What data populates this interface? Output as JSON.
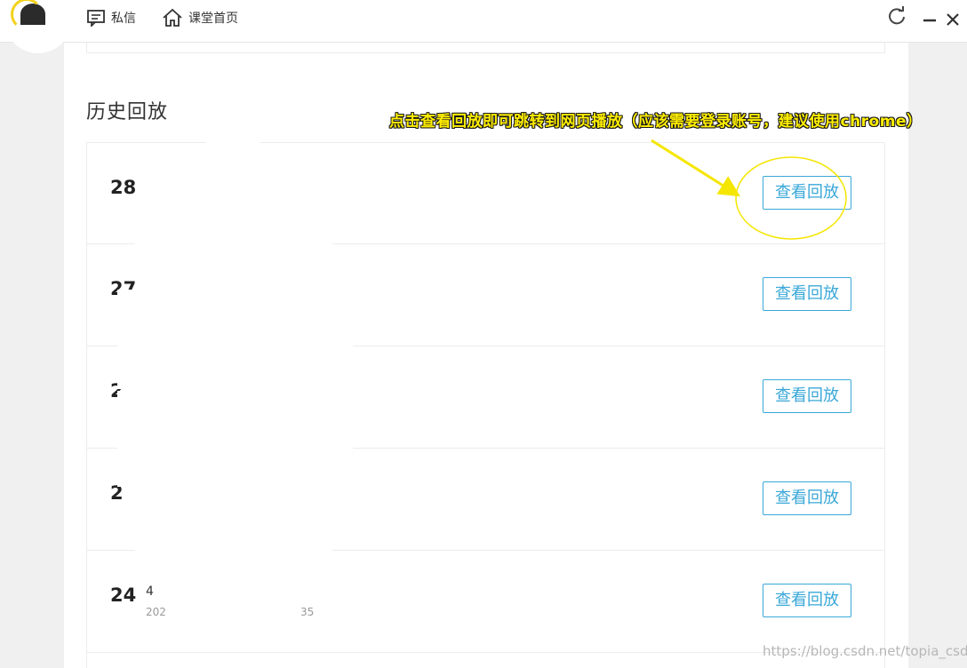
{
  "topbar": {
    "nav": [
      {
        "label": "私信",
        "icon": "message-icon"
      },
      {
        "label": "课堂首页",
        "icon": "home-icon"
      }
    ],
    "controls": [
      "refresh-icon",
      "minimize-icon",
      "close-icon"
    ]
  },
  "section": {
    "title": "历史回放"
  },
  "annotation": {
    "text": "点击查看回放即可跳转到网页播放（应该需要登录账号，建议使用chrome）",
    "color": "#ffee00"
  },
  "rows": [
    {
      "num": "28",
      "title": "",
      "date": "",
      "button": "查看回放"
    },
    {
      "num": "27",
      "title": "",
      "date": "",
      "button": "查看回放"
    },
    {
      "num": "2",
      "title": "",
      "date": "",
      "button": "查看回放"
    },
    {
      "num": "2",
      "title": "",
      "date": "",
      "button": "查看回放"
    },
    {
      "num": "24",
      "title": "4",
      "date": "202",
      "date_tail": "35",
      "button": "查看回放"
    }
  ],
  "watermark": "https://blog.csdn.net/topia_csdn",
  "colors": {
    "accent": "#3aa8d8",
    "annotation": "#ffee00",
    "highlight_circle": "#f5e600"
  }
}
